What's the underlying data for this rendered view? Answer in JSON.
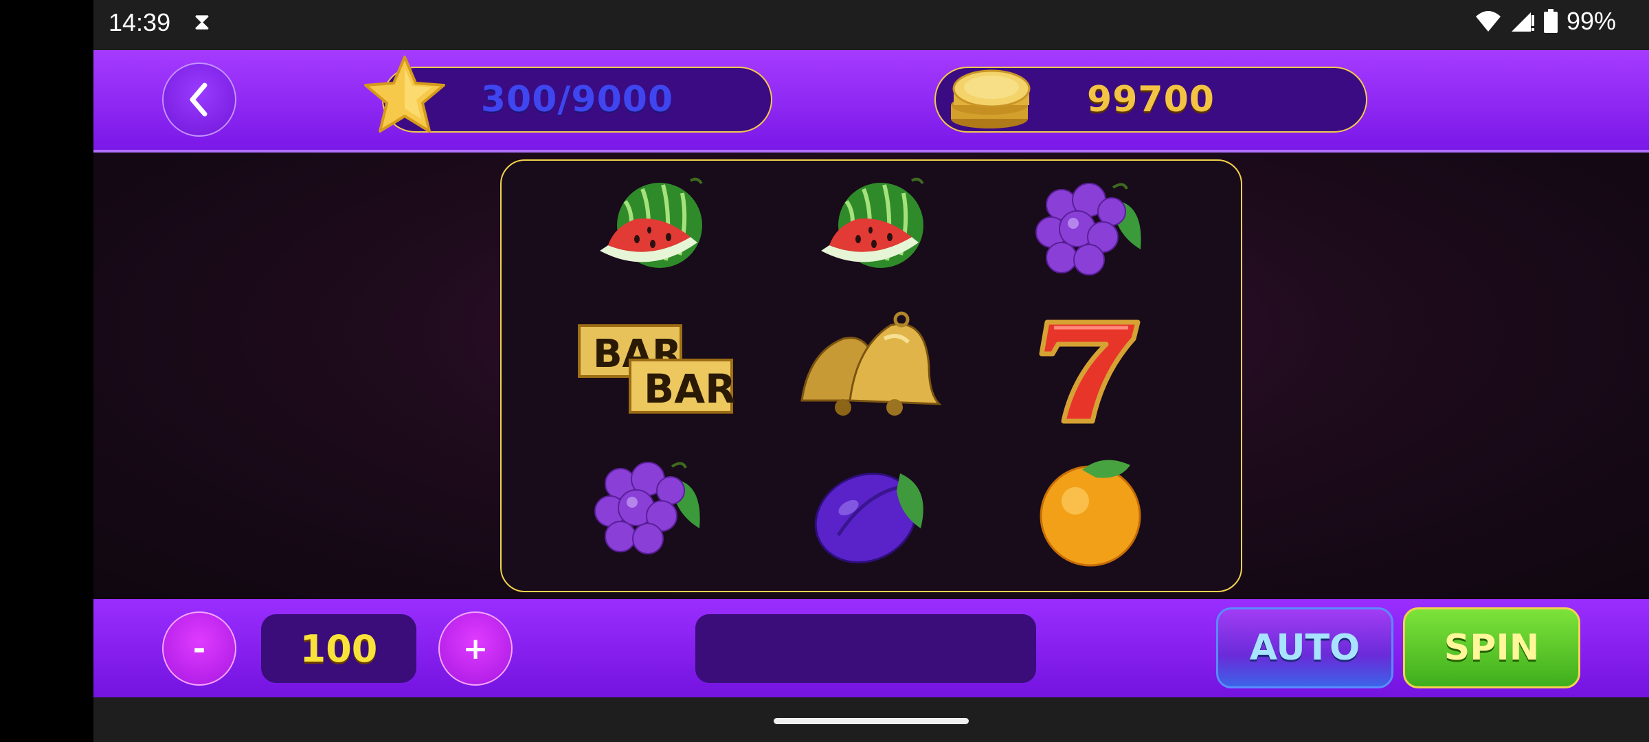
{
  "status_bar": {
    "time": "14:39",
    "battery": "99%",
    "icons": [
      "hourglass-icon",
      "wifi-icon",
      "signal-icon",
      "battery-icon"
    ]
  },
  "header": {
    "back_icon": "chevron-left-icon",
    "xp_text": "300/9000",
    "coins_text": "99700"
  },
  "reels": {
    "grid": [
      [
        "watermelon",
        "watermelon",
        "grapes"
      ],
      [
        "double-bar",
        "bells",
        "seven"
      ],
      [
        "grapes",
        "plum",
        "orange"
      ]
    ]
  },
  "bottom": {
    "minus_label": "-",
    "bet_value": "100",
    "plus_label": "+",
    "win_value": "",
    "auto_label": "AUTO",
    "spin_label": "SPIN"
  },
  "colors": {
    "accent_purple": "#8a24f0",
    "gold": "#f2d34d",
    "spin_green": "#4fc42a",
    "auto_blue": "#3c64e8"
  }
}
